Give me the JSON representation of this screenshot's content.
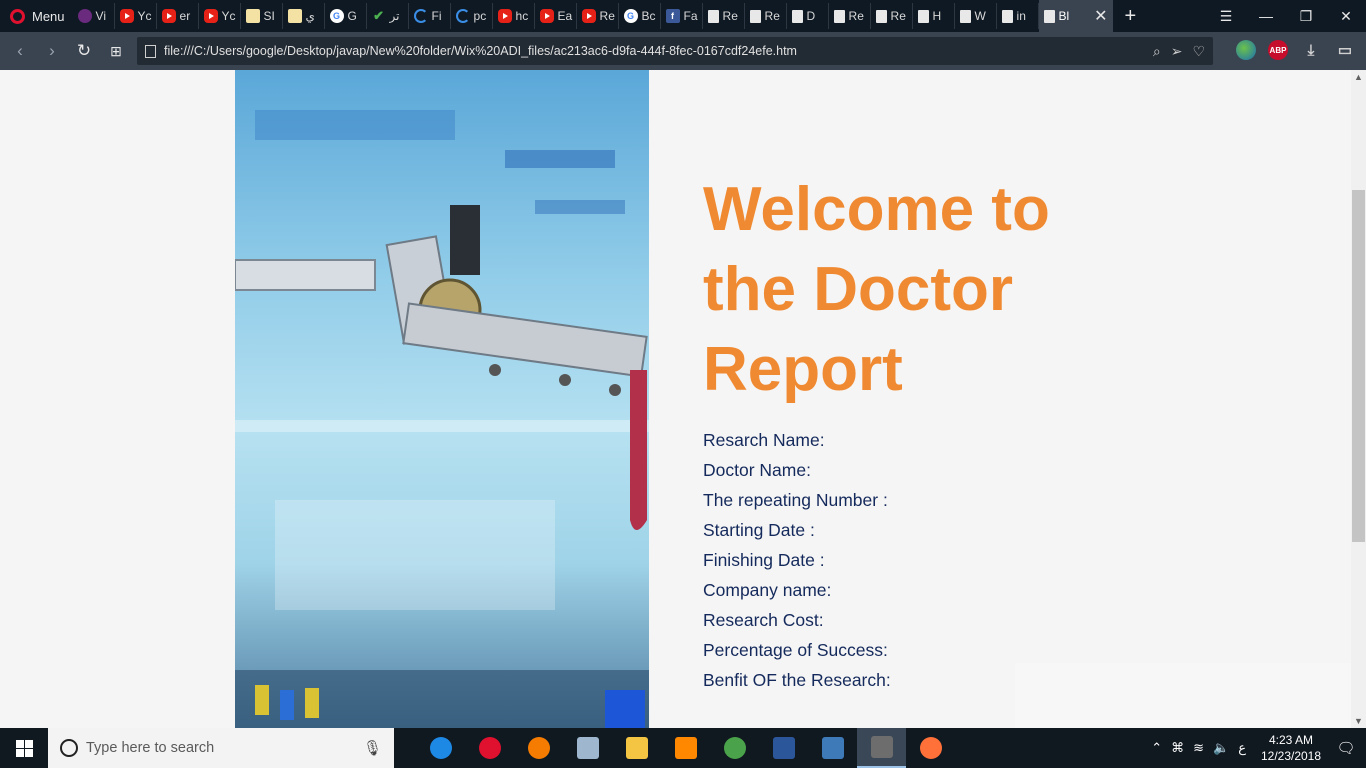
{
  "browser": {
    "menu_label": "Menu",
    "tabs": [
      {
        "label": "Vi",
        "icon": "purple-app-icon"
      },
      {
        "label": "Yc",
        "icon": "youtube-icon"
      },
      {
        "label": "er",
        "icon": "youtube-icon"
      },
      {
        "label": "Yc",
        "icon": "youtube-icon"
      },
      {
        "label": "SI",
        "icon": "note-icon"
      },
      {
        "label": "ي",
        "icon": "note-icon"
      },
      {
        "label": "G",
        "icon": "google-icon"
      },
      {
        "label": "تر",
        "icon": "checkmark-icon"
      },
      {
        "label": "Fi",
        "icon": "circle-arrow-icon"
      },
      {
        "label": "pc",
        "icon": "circle-arrow-icon"
      },
      {
        "label": "hc",
        "icon": "youtube-icon"
      },
      {
        "label": "Ea",
        "icon": "youtube-icon"
      },
      {
        "label": "Re",
        "icon": "youtube-icon"
      },
      {
        "label": "Bc",
        "icon": "google-icon"
      },
      {
        "label": "Fa",
        "icon": "facebook-icon"
      },
      {
        "label": "Re",
        "icon": "page-icon"
      },
      {
        "label": "Re",
        "icon": "page-icon"
      },
      {
        "label": "D",
        "icon": "page-icon"
      },
      {
        "label": "Re",
        "icon": "page-icon"
      },
      {
        "label": "Re",
        "icon": "page-icon"
      },
      {
        "label": "H",
        "icon": "page-icon"
      },
      {
        "label": "W",
        "icon": "page-icon"
      },
      {
        "label": "in",
        "icon": "page-icon"
      }
    ],
    "active_tab_label": "Bl",
    "new_tab_symbol": "+",
    "url": "file:///C:/Users/google/Desktop/javap/New%20folder/Wix%20ADI_files/ac213ac6-d9fa-444f-8fec-0167cdf24efe.htm",
    "abp_label": "ABP"
  },
  "page": {
    "heading": "Welcome to the Doctor Report",
    "fields": [
      "Resarch Name:",
      "Doctor Name:",
      "The repeating Number :",
      "Starting Date :",
      "Finishing Date :",
      "Company name:",
      "Research Cost:",
      "Percentage of Success:",
      "Benfit OF the Research:"
    ],
    "accent_color": "#f08a32",
    "text_color": "#152a5c"
  },
  "taskbar": {
    "search_placeholder": "Type here to search",
    "apps": [
      "edge-icon",
      "opera-icon",
      "uc-browser-icon",
      "monitor-app-icon",
      "file-explorer-icon",
      "vlc-icon",
      "globe-app-icon",
      "word-icon",
      "bracket-app-icon",
      "media-player-icon",
      "firefox-icon"
    ],
    "lang": "ع",
    "time": "4:23 AM",
    "date": "12/23/2018"
  }
}
